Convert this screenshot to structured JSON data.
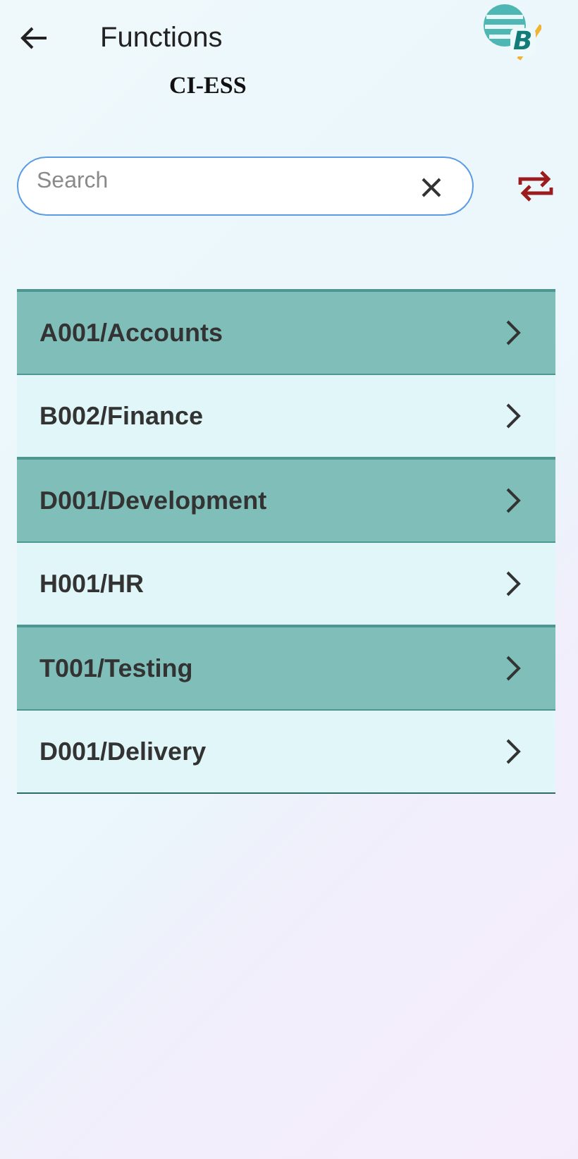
{
  "header": {
    "title": "Functions",
    "logo_text": "B"
  },
  "subtitle": "CI-ESS",
  "search": {
    "placeholder": "Search"
  },
  "items": [
    {
      "label": "A001/Accounts"
    },
    {
      "label": "B002/Finance"
    },
    {
      "label": "D001/Development"
    },
    {
      "label": "H001/HR"
    },
    {
      "label": "T001/Testing"
    },
    {
      "label": "D001/Delivery"
    }
  ]
}
